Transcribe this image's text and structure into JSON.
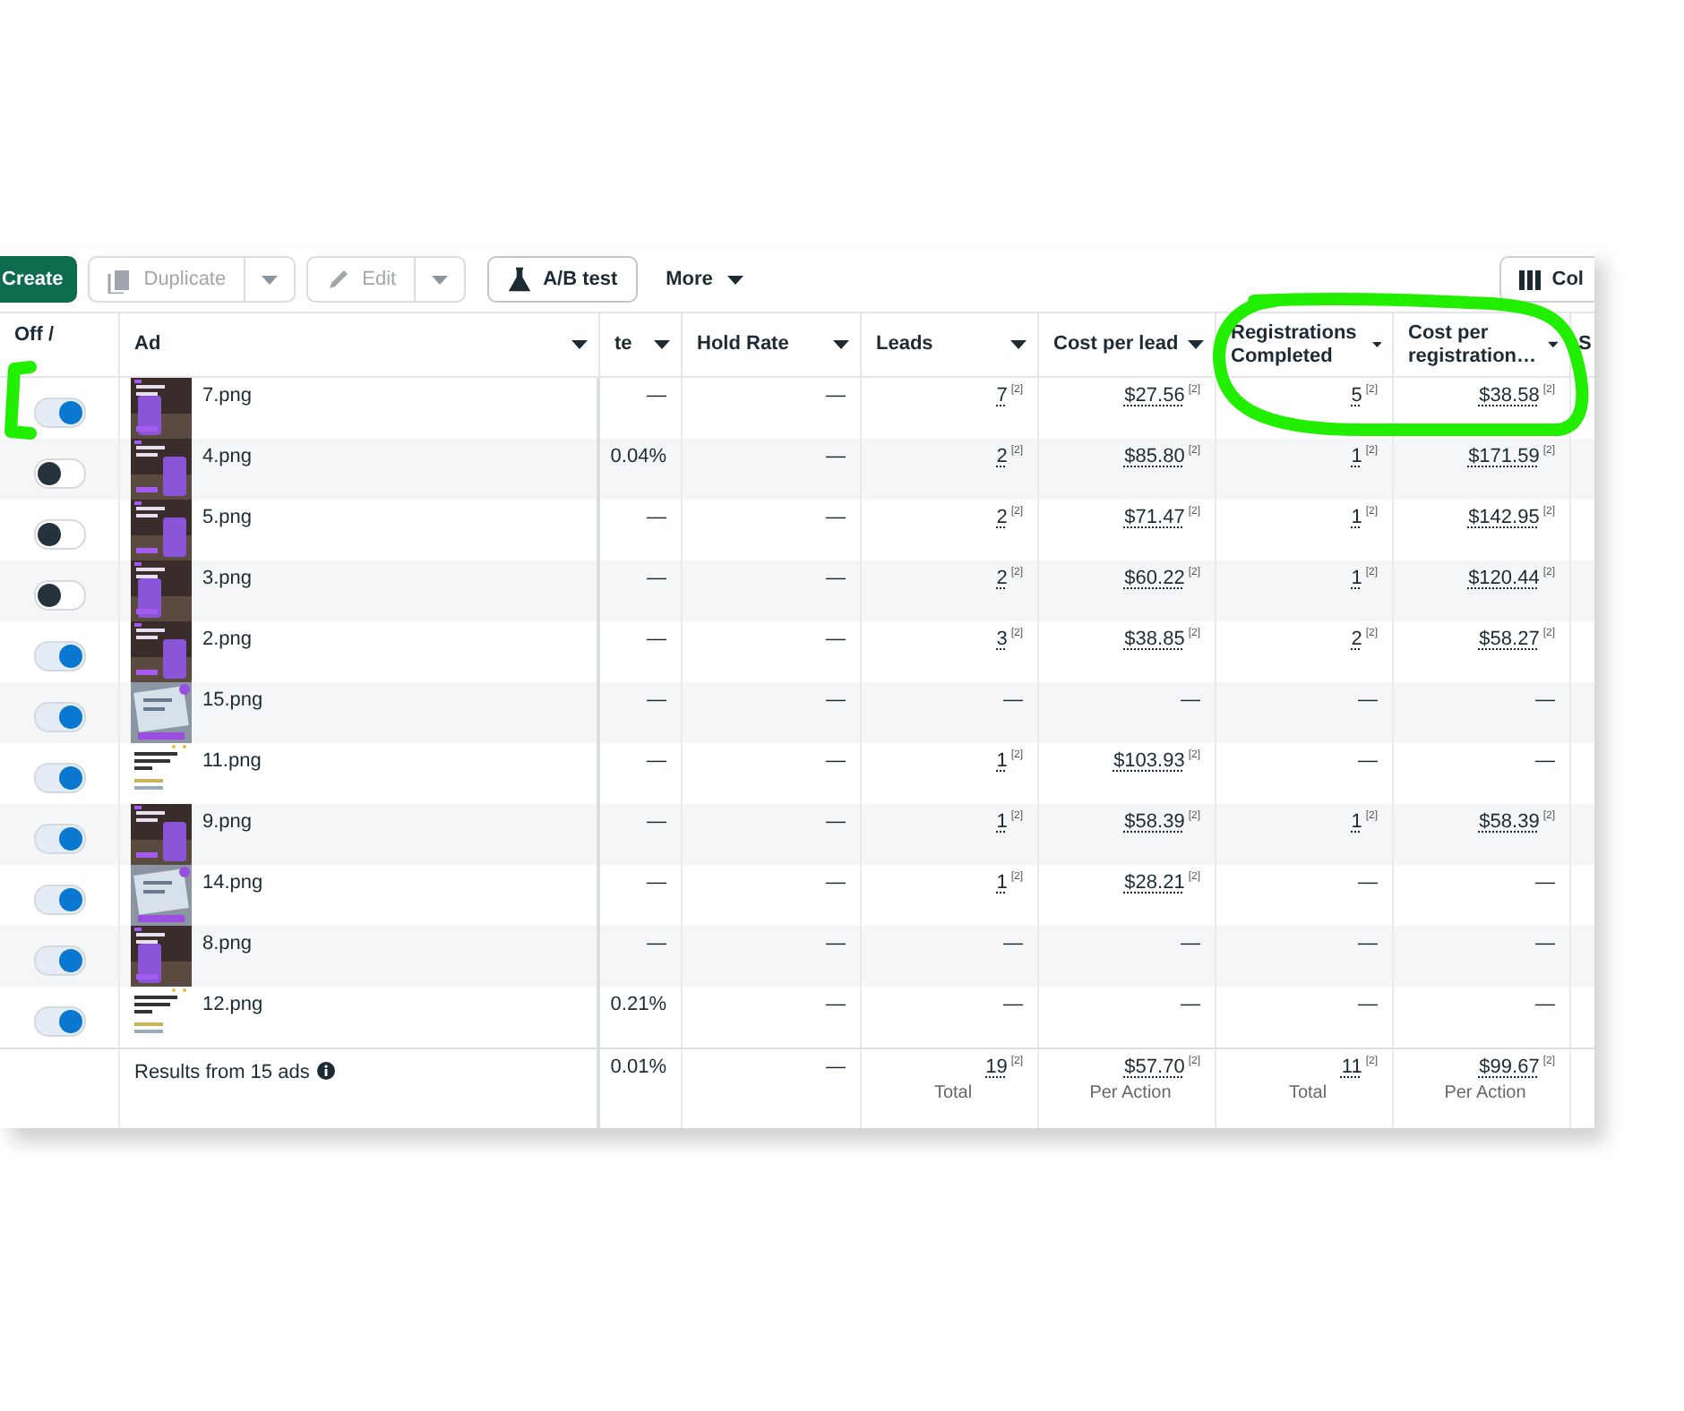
{
  "toolbar": {
    "buttons": [
      {
        "kind": "primary",
        "label": "Create"
      },
      {
        "kind": "split",
        "label": "Duplicate"
      },
      {
        "kind": "split",
        "label": "Edit"
      },
      {
        "kind": "outline",
        "label": "A/B test"
      },
      {
        "kind": "menu",
        "label": "More"
      },
      {
        "kind": "columns",
        "label": "Col"
      }
    ]
  },
  "table": {
    "toggle_column": {
      "label": "Off /"
    },
    "ad_column": {
      "label": "Ad"
    },
    "columns": [
      {
        "label": "te"
      },
      {
        "label": "Hold Rate"
      },
      {
        "label": "Leads"
      },
      {
        "label": "Cost per lead"
      },
      {
        "label": "Registrations Completed"
      },
      {
        "label": "Cost per registration…"
      },
      {
        "label": "S"
      }
    ],
    "rows": [
      {
        "on": true,
        "ad": "7.png",
        "thumbnail": {
          "kind": "picture"
        },
        "cells": [
          {
            "value": "—"
          },
          {
            "value": "—"
          },
          {
            "value": "7",
            "note": "[2]"
          },
          {
            "value": "$27.56",
            "note": "[2]"
          },
          {
            "value": "5",
            "note": "[2]"
          },
          {
            "value": "$38.58",
            "note": "[2]"
          }
        ]
      },
      {
        "on": false,
        "ad": "4.png",
        "thumbnail": {
          "kind": "picture"
        },
        "cells": [
          {
            "value": "0.04%"
          },
          {
            "value": "—"
          },
          {
            "value": "2",
            "note": "[2]"
          },
          {
            "value": "$85.80",
            "note": "[2]"
          },
          {
            "value": "1",
            "note": "[2]"
          },
          {
            "value": "$171.59",
            "note": "[2]"
          }
        ]
      },
      {
        "on": false,
        "ad": "5.png",
        "thumbnail": {
          "kind": "picture"
        },
        "cells": [
          {
            "value": "—"
          },
          {
            "value": "—"
          },
          {
            "value": "2",
            "note": "[2]"
          },
          {
            "value": "$71.47",
            "note": "[2]"
          },
          {
            "value": "1",
            "note": "[2]"
          },
          {
            "value": "$142.95",
            "note": "[2]"
          }
        ]
      },
      {
        "on": false,
        "ad": "3.png",
        "thumbnail": {
          "kind": "picture"
        },
        "cells": [
          {
            "value": "—"
          },
          {
            "value": "—"
          },
          {
            "value": "2",
            "note": "[2]"
          },
          {
            "value": "$60.22",
            "note": "[2]"
          },
          {
            "value": "1",
            "note": "[2]"
          },
          {
            "value": "$120.44",
            "note": "[2]"
          }
        ]
      },
      {
        "on": true,
        "ad": "2.png",
        "thumbnail": {
          "kind": "picture"
        },
        "cells": [
          {
            "value": "—"
          },
          {
            "value": "—"
          },
          {
            "value": "3",
            "note": "[2]"
          },
          {
            "value": "$38.85",
            "note": "[2]"
          },
          {
            "value": "2",
            "note": "[2]"
          },
          {
            "value": "$58.27",
            "note": "[2]"
          }
        ]
      },
      {
        "on": true,
        "ad": "15.png",
        "thumbnail": {
          "kind": "picture"
        },
        "cells": [
          {
            "value": "—"
          },
          {
            "value": "—"
          },
          {
            "value": "—"
          },
          {
            "value": "—"
          },
          {
            "value": "—"
          },
          {
            "value": "—"
          }
        ]
      },
      {
        "on": true,
        "ad": "11.png",
        "thumbnail": {
          "kind": "picture"
        },
        "cells": [
          {
            "value": "—"
          },
          {
            "value": "—"
          },
          {
            "value": "1",
            "note": "[2]"
          },
          {
            "value": "$103.93",
            "note": "[2]"
          },
          {
            "value": "—"
          },
          {
            "value": "—"
          }
        ]
      },
      {
        "on": true,
        "ad": "9.png",
        "thumbnail": {
          "kind": "picture"
        },
        "cells": [
          {
            "value": "—"
          },
          {
            "value": "—"
          },
          {
            "value": "1",
            "note": "[2]"
          },
          {
            "value": "$58.39",
            "note": "[2]"
          },
          {
            "value": "1",
            "note": "[2]"
          },
          {
            "value": "$58.39",
            "note": "[2]"
          }
        ]
      },
      {
        "on": true,
        "ad": "14.png",
        "thumbnail": {
          "kind": "picture"
        },
        "cells": [
          {
            "value": "—"
          },
          {
            "value": "—"
          },
          {
            "value": "1",
            "note": "[2]"
          },
          {
            "value": "$28.21",
            "note": "[2]"
          },
          {
            "value": "—"
          },
          {
            "value": "—"
          }
        ]
      },
      {
        "on": true,
        "ad": "8.png",
        "thumbnail": {
          "kind": "picture"
        },
        "cells": [
          {
            "value": "—"
          },
          {
            "value": "—"
          },
          {
            "value": "—"
          },
          {
            "value": "—"
          },
          {
            "value": "—"
          },
          {
            "value": "—"
          }
        ]
      },
      {
        "on": true,
        "ad": "12.png",
        "thumbnail": {
          "kind": "picture"
        },
        "cells": [
          {
            "value": "0.21%"
          },
          {
            "value": "—"
          },
          {
            "value": "—"
          },
          {
            "value": "—"
          },
          {
            "value": "—"
          },
          {
            "value": "—"
          }
        ]
      }
    ],
    "footer": {
      "label": "Results from 15 ads",
      "cells": [
        {
          "value": "0.01%"
        },
        {
          "value": "—"
        },
        {
          "value": "19",
          "note": "[2]",
          "sub": "Total"
        },
        {
          "value": "$57.70",
          "note": "[2]",
          "sub": "Per Action"
        },
        {
          "value": "11",
          "note": "[2]",
          "sub": "Total"
        },
        {
          "value": "$99.67",
          "note": "[2]",
          "sub": "Per Action"
        }
      ]
    }
  },
  "annotations": [
    {
      "kind": "bracket"
    },
    {
      "kind": "circle"
    }
  ]
}
